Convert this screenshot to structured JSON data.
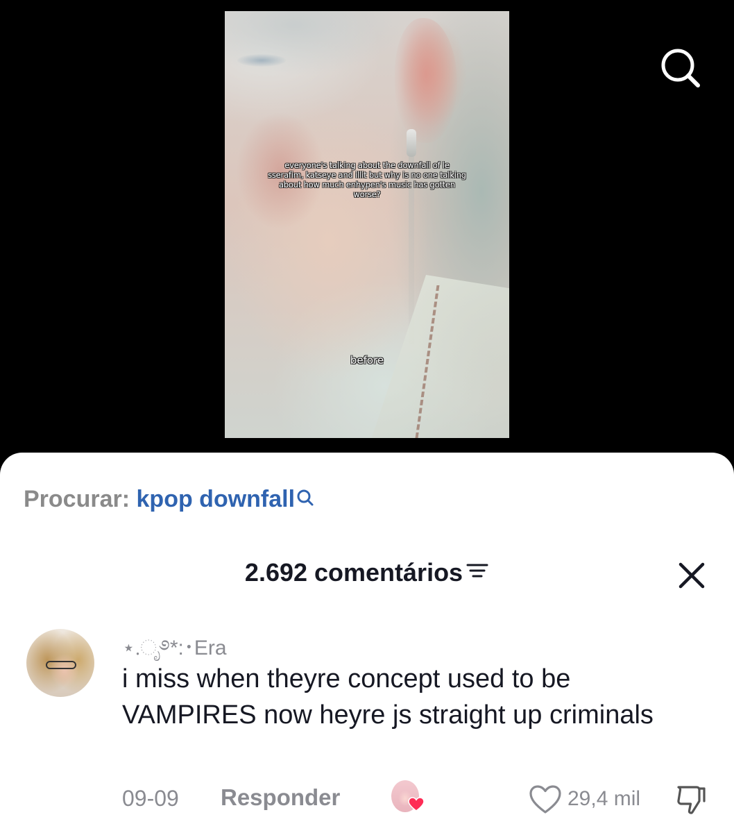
{
  "video": {
    "caption": "everyone's talking about the downfall of le sserafim, katseye and illit but why is no one talking about how much enhypen's music has gotten worse?",
    "subcaption": "before"
  },
  "top_bar": {
    "search_icon": "search-icon"
  },
  "search_suggestion": {
    "prefix": "Procurar:",
    "query": "kpop downfall",
    "icon": "search-icon"
  },
  "comments_header": {
    "count_label": "2.692 comentários",
    "filter_icon": "filter-icon",
    "close_icon": "close-icon"
  },
  "comment": {
    "username": "⋆.ೃ࿔*:･Era",
    "text": "i miss when theyre concept used to be VAMPIRES now heyre js straight up criminals",
    "date": "09-09",
    "reply_label": "Responder",
    "creator_liked_icon": "creator-liked-heart-icon",
    "like_count": "29,4 mil",
    "like_icon": "heart-outline-icon",
    "dislike_icon": "thumbs-down-icon"
  },
  "colors": {
    "link_blue": "#2f63b0",
    "muted_gray": "#8a8b91",
    "text_dark": "#161823",
    "heart_pink": "#fe2c55"
  }
}
